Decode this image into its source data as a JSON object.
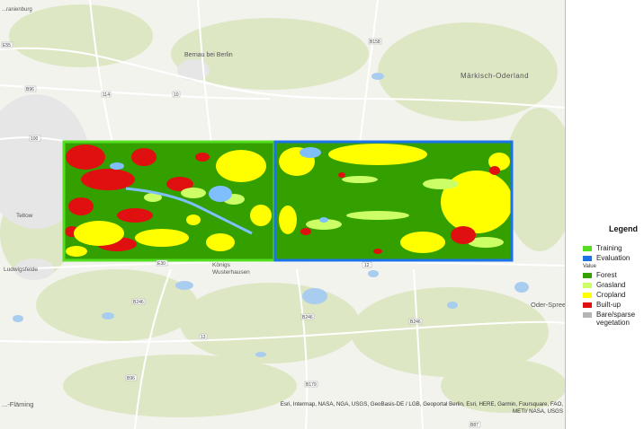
{
  "map": {
    "place_labels": {
      "oranienburg": "...ranienburg",
      "bernau": "Bernau bei Berlin",
      "maerkisch_oderland": "Märkisch-Oderland",
      "teltow": "Teltow",
      "ludwigsfelde": "Ludwigsfelde",
      "koenigs_wusterhausen": "Königs\nWusterhausen",
      "oder_spree": "Oder-Spree",
      "flaeming": "...-Fläming"
    },
    "road_shields": [
      "E55",
      "B96",
      "114",
      "B158",
      "10",
      "100",
      "E30",
      "B246",
      "12",
      "B246",
      "B246",
      "13",
      "B96",
      "B179",
      "B87"
    ],
    "colors": {
      "background": "#f3f3ee",
      "forest_light": "#dde7c4",
      "water": "#a9cdef",
      "urban": "#e4e4e4"
    }
  },
  "legend": {
    "title": "Legend",
    "items": [
      {
        "label": "Training",
        "color": "#55dd22"
      },
      {
        "label": "Evaluation",
        "color": "#1a73e8"
      }
    ],
    "value_heading": "Value",
    "classes": [
      {
        "label": "Forest",
        "color": "#33a000"
      },
      {
        "label": "Grasland",
        "color": "#ccff66"
      },
      {
        "label": "Cropland",
        "color": "#ffff00"
      },
      {
        "label": "Built-up",
        "color": "#e01010"
      },
      {
        "label": "Bare/sparse vegetation",
        "color": "#b4b4b4"
      }
    ]
  },
  "attribution": "Esri, Intermap, NASA, NGA, USGS, GeoBasis-DE / LGB, Geoportal Berlin, Esri, HERE, Garmin, Foursquare, FAO, METI/ NASA, USGS"
}
